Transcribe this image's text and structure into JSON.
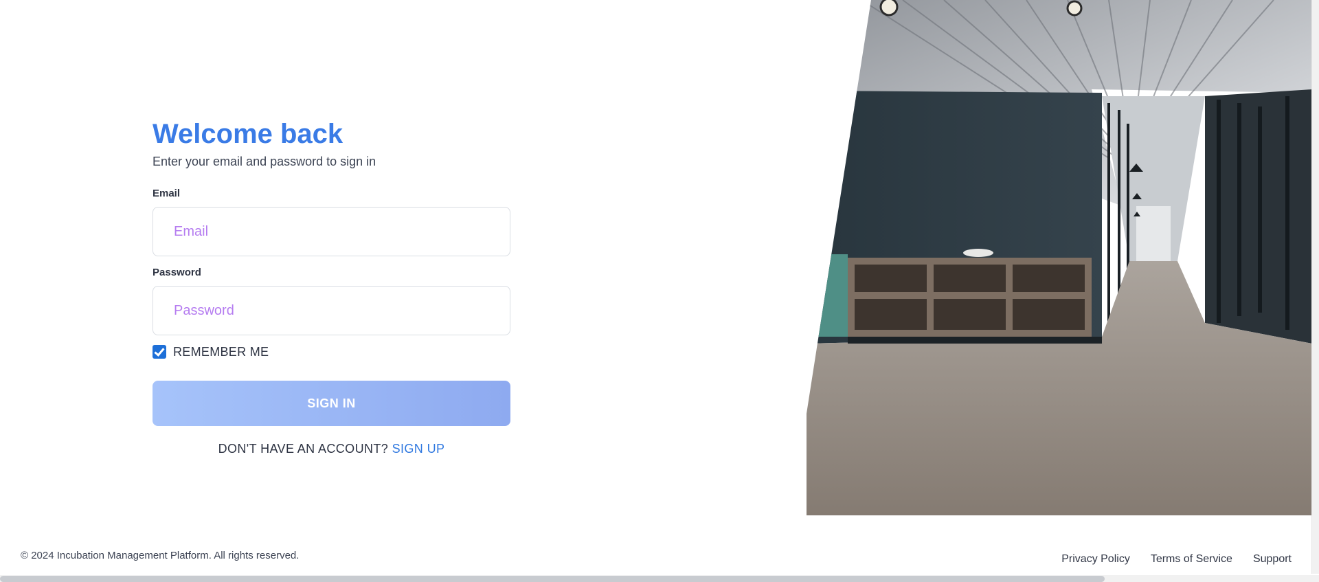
{
  "login": {
    "title": "Welcome back",
    "subtitle": "Enter your email and password to sign in",
    "email_label": "Email",
    "email_placeholder": "Email",
    "email_value": "",
    "password_label": "Password",
    "password_placeholder": "Password",
    "password_value": "",
    "remember_label": "REMEMBER ME",
    "remember_checked": true,
    "signin_label": "SIGN IN",
    "no_account_text": "DON'T HAVE AN ACCOUNT?",
    "signup_label": "SIGN UP"
  },
  "footer": {
    "copyright": "© 2024 Incubation Management Platform. All rights reserved.",
    "links": [
      {
        "label": "Privacy Policy"
      },
      {
        "label": "Terms of Service"
      },
      {
        "label": "Support"
      }
    ]
  },
  "colors": {
    "accent": "#3a7be6",
    "link": "#2f78e0",
    "placeholder": "#b57cf0",
    "button_gradient_start": "#a6c3fa",
    "button_gradient_end": "#8eaaf0",
    "checkbox": "#1d6fd8"
  }
}
